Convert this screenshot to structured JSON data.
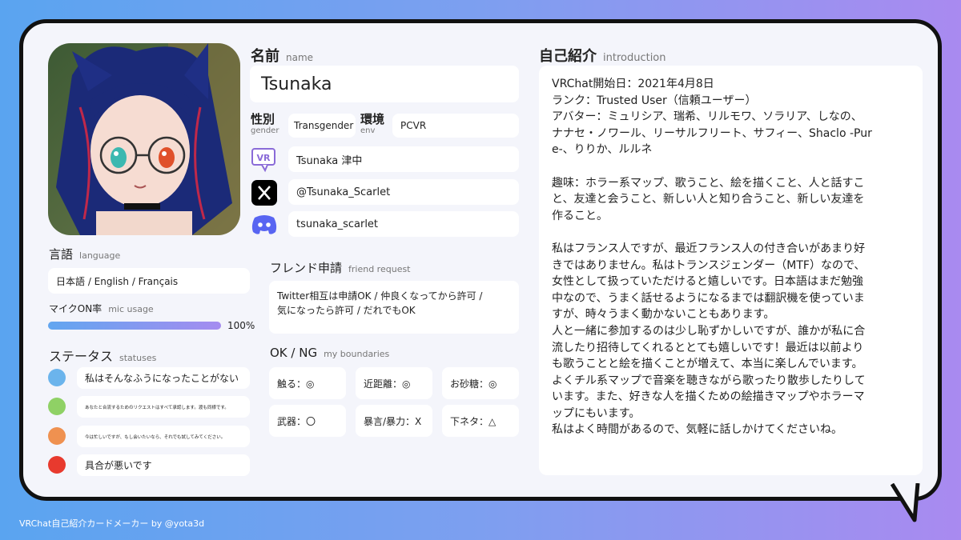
{
  "name": {
    "label": "名前",
    "sub": "name",
    "value": "Tsunaka"
  },
  "gender": {
    "label": "性別",
    "sub": "gender",
    "value": "Transgender"
  },
  "env": {
    "label": "環境",
    "sub": "env",
    "value": "PCVR"
  },
  "socials": {
    "vrchat": {
      "icon": "vrchat-icon",
      "value": "Tsunaka 津中"
    },
    "x": {
      "icon": "x-icon",
      "value": "@Tsunaka_Scarlet"
    },
    "discord": {
      "icon": "discord-icon",
      "value": "tsunaka_scarlet"
    }
  },
  "language": {
    "label": "言語",
    "sub": "language",
    "value": "日本語 / English / Français"
  },
  "mic": {
    "label": "マイクON率",
    "sub": "mic usage",
    "percent_text": "100%",
    "fraction": 1.0
  },
  "statuses": {
    "label": "ステータス",
    "sub": "statuses",
    "items": [
      {
        "color": "#6bb4ec",
        "text": "私はそんなふうになったことがない"
      },
      {
        "color": "#8fd165",
        "text": "あなたと合流するためのリクエストはすべて承認します。渡も同様です。"
      },
      {
        "color": "#ef9150",
        "text": "今は忙しいですが、もし会いたいなら、それでも試してみてください。"
      },
      {
        "color": "#e83a2e",
        "text": "具合が悪いです"
      }
    ]
  },
  "friend_request": {
    "label": "フレンド申請",
    "sub": "friend request",
    "line1": "Twitter相互は申請OK / 仲良くなってから許可 /",
    "line2": "気になったら許可 / だれでもOK"
  },
  "boundaries": {
    "label": "OK / NG",
    "sub": "my boundaries",
    "items": [
      "触る：◎",
      "近距離：◎",
      "お砂糖：◎",
      "武器：〇",
      "暴言/暴力：Ⅹ",
      "下ネタ：△"
    ]
  },
  "intro": {
    "label": "自己紹介",
    "sub": "introduction",
    "text": "VRChat開始日：2021年4月8日\nランク：Trusted User（信頼ユーザー）\nアバター：ミュリシア、瑞希、リルモワ、ソラリア、しなの、\nナナセ・ノワール、リーサルフリート、サフィー、Shaclo -Pur\ne-、りりか、ルルネ\n\n趣味：ホラー系マップ、歌うこと、絵を描くこと、人と話すこ\nと、友達と会うこと、新しい人と知り合うこと、新しい友達を\n作ること。\n\n私はフランス人ですが、最近フランス人の付き合いがあまり好\nきではありません。私はトランスジェンダー（MTF）なので、\n女性として扱っていただけると嬉しいです。日本語はまだ勉強\n中なので、うまく話せるようになるまでは翻訳機を使っていま\nすが、時々うまく動かないこともあります。\n人と一緒に参加するのは少し恥ずかしいですが、誰かが私に合\n流したり招待してくれるととても嬉しいです！最近は以前より\nも歌うことと絵を描くことが増えて、本当に楽しんでいます。\nよくチル系マップで音楽を聴きながら歌ったり散歩したりして\nいます。また、好きな人を描くための絵描きマップやホラーマ\nップにもいます。\n私はよく時間があるので、気軽に話しかけてくださいね。"
  },
  "footer": "VRChat自己紹介カードメーカー by @yota3d",
  "colors": {
    "bar_start": "#62a6f0",
    "bar_end": "#a58cf0",
    "discord": "#5865f2"
  }
}
